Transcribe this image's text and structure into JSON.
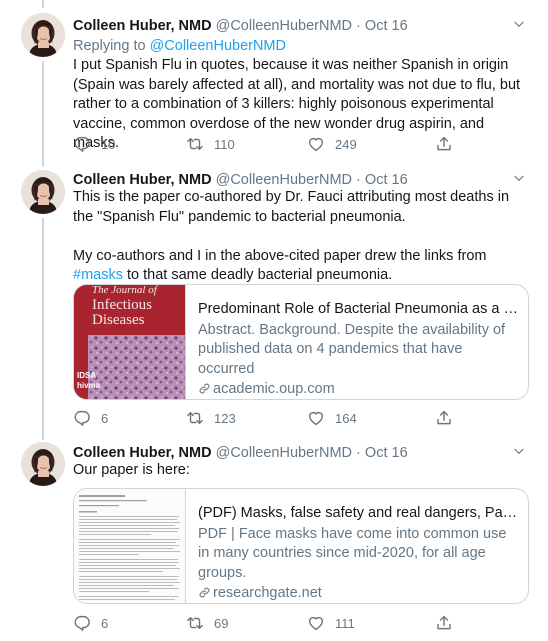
{
  "tweets": [
    {
      "author_name": "Colleen Huber, NMD",
      "author_handle": "@ColleenHuberNMD",
      "separator": "·",
      "date": "Oct 16",
      "replying_prefix": "Replying to",
      "replying_handle": "@ColleenHuberNMD",
      "text": "I put Spanish Flu in quotes, because it was neither Spanish in origin (Spain was barely affected at all), and mortality was not due to flu, but rather to a combination of 3 killers: highly poisonous experimental vaccine, common overdose of the new wonder drug aspirin, and masks.",
      "replies": "10",
      "retweets": "110",
      "likes": "249"
    },
    {
      "author_name": "Colleen Huber, NMD",
      "author_handle": "@ColleenHuberNMD",
      "separator": "·",
      "date": "Oct 16",
      "text_line1": "This is the paper co-authored by Dr. Fauci attributing most deaths in the \"Spanish Flu\" pandemic to bacterial pneumonia.",
      "text_line2_prefix": "My co-authors and I in the above-cited paper drew the links from",
      "hashtag": "#masks",
      "text_line2_suffix": "to that same deadly bacterial pneumonia.",
      "card": {
        "image_title_line1": "The Journal of",
        "image_title_line2": "Infectious",
        "image_title_line3": "Diseases",
        "image_footer_line1": "IDSA",
        "image_footer_line2": "hivma",
        "title": "Predominant Role of Bacterial Pneumonia as a Ca...",
        "description": "Abstract. Background. Despite the availability of published data on 4 pandemics that have occurred",
        "domain": "academic.oup.com"
      },
      "replies": "6",
      "retweets": "123",
      "likes": "164"
    },
    {
      "author_name": "Colleen Huber, NMD",
      "author_handle": "@ColleenHuberNMD",
      "separator": "·",
      "date": "Oct 16",
      "text": "Our paper is here:",
      "card": {
        "title": "(PDF) Masks, false safety and real dangers, Part ...",
        "description": "PDF | Face masks have come into common use in many countries since mid-2020, for all age groups.",
        "domain": "researchgate.net"
      },
      "replies": "6",
      "retweets": "69",
      "likes": "111"
    }
  ],
  "colors": {
    "accent": "#1da1f2",
    "muted": "#657786",
    "text": "#14171a",
    "journal_red": "#a8252f"
  },
  "icons": [
    "chevron-down-icon",
    "reply-icon",
    "retweet-icon",
    "like-icon",
    "share-icon",
    "link-icon"
  ]
}
